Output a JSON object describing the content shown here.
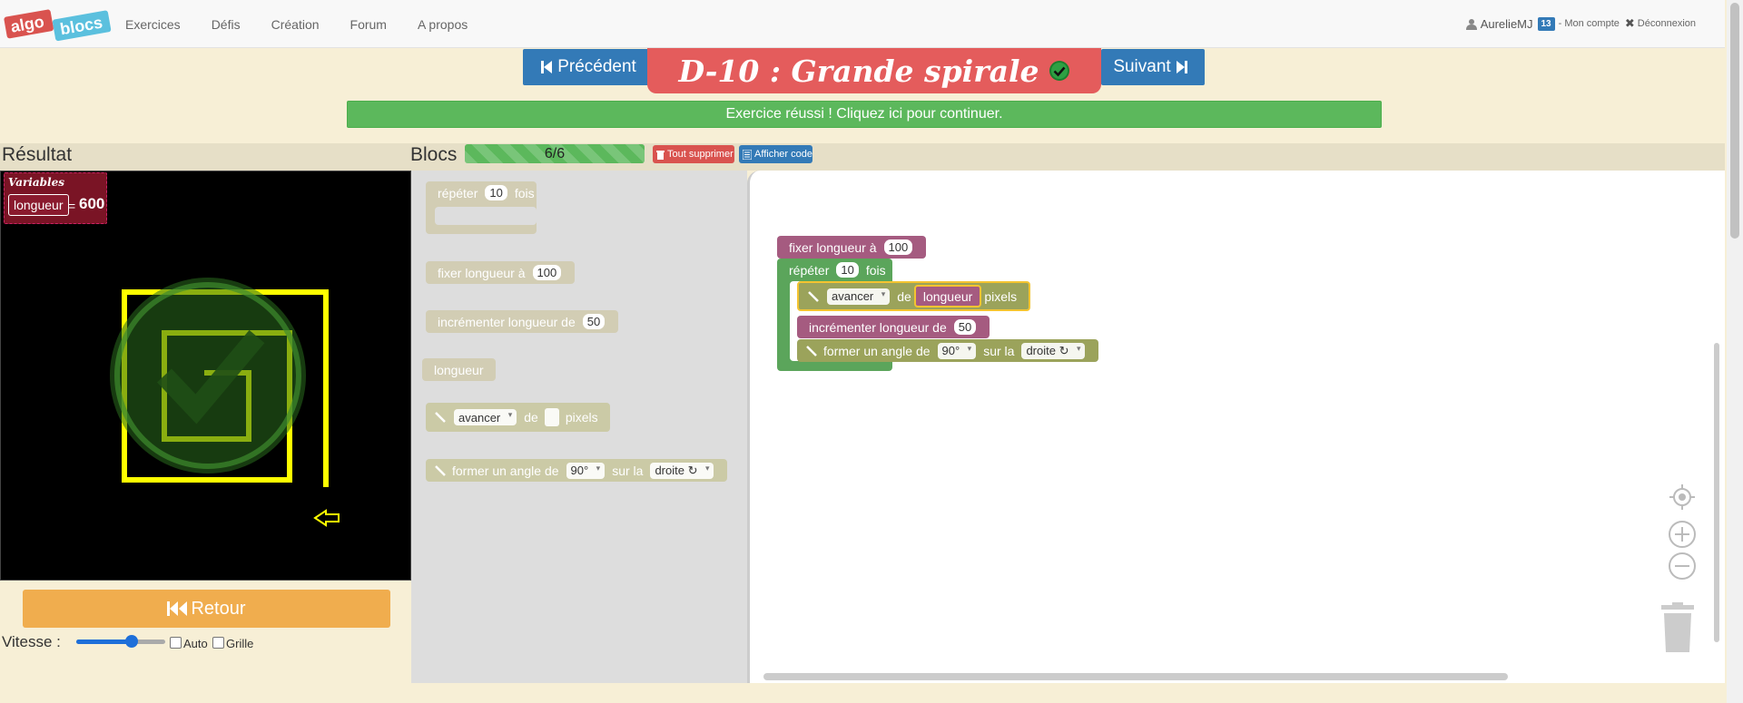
{
  "nav": {
    "logo_left": "algo",
    "logo_right": "blocs",
    "links": [
      "Exercices",
      "Défis",
      "Création",
      "Forum",
      "A propos"
    ],
    "username": "AurelieMJ",
    "badge": "13",
    "account": "- Mon compte",
    "logout": "Déconnexion"
  },
  "exercise": {
    "prev_label": "Précédent",
    "next_label": "Suivant",
    "title": "D-10 : Grande spirale",
    "success_message": "Exercice réussi ! Cliquez ici pour continuer."
  },
  "result": {
    "title": "Résultat",
    "vars_title": "Variables",
    "var_name": "longueur",
    "var_eq": "=",
    "var_value": "600",
    "retour_label": "Retour",
    "speed_label": "Vitesse :",
    "speed_level": 0.62,
    "auto_label": "Auto",
    "grid_label": "Grille"
  },
  "blocks": {
    "title": "Blocs",
    "progress_text": "6/6",
    "progress_fraction": 1.0,
    "delete_all": "Tout supprimer",
    "show_code": "Afficher code"
  },
  "toolbox": {
    "repeat": {
      "prefix": "répéter",
      "count": "10",
      "suffix": "fois"
    },
    "set": {
      "prefix": "fixer longueur à",
      "value": "100"
    },
    "increment": {
      "prefix": "incrémenter longueur de",
      "value": "50"
    },
    "variable": "longueur",
    "forward": {
      "action": "avancer",
      "de": "de",
      "suffix": "pixels"
    },
    "turn": {
      "prefix": "former un angle de",
      "angle": "90°",
      "sur": "sur la",
      "direction": "droite ↻"
    }
  },
  "workspace": {
    "set": {
      "prefix": "fixer longueur à",
      "value": "100"
    },
    "repeat": {
      "prefix": "répéter",
      "count": "10",
      "suffix": "fois"
    },
    "forward": {
      "action": "avancer",
      "de": "de",
      "var": "longueur",
      "suffix": "pixels"
    },
    "increment": {
      "prefix": "incrémenter longueur de",
      "value": "50"
    },
    "turn": {
      "prefix": "former un angle de",
      "angle": "90°",
      "sur": "sur la",
      "direction": "droite ↻"
    }
  },
  "colors": {
    "block_purple": "#a55b80",
    "block_green": "#5ba55b",
    "block_olive": "#9ba35b",
    "drawing_line": "#ffff00",
    "success": "#5cb85c",
    "title_red": "#e45c5c",
    "primary": "#337ab7",
    "warning": "#f0ad4e"
  }
}
